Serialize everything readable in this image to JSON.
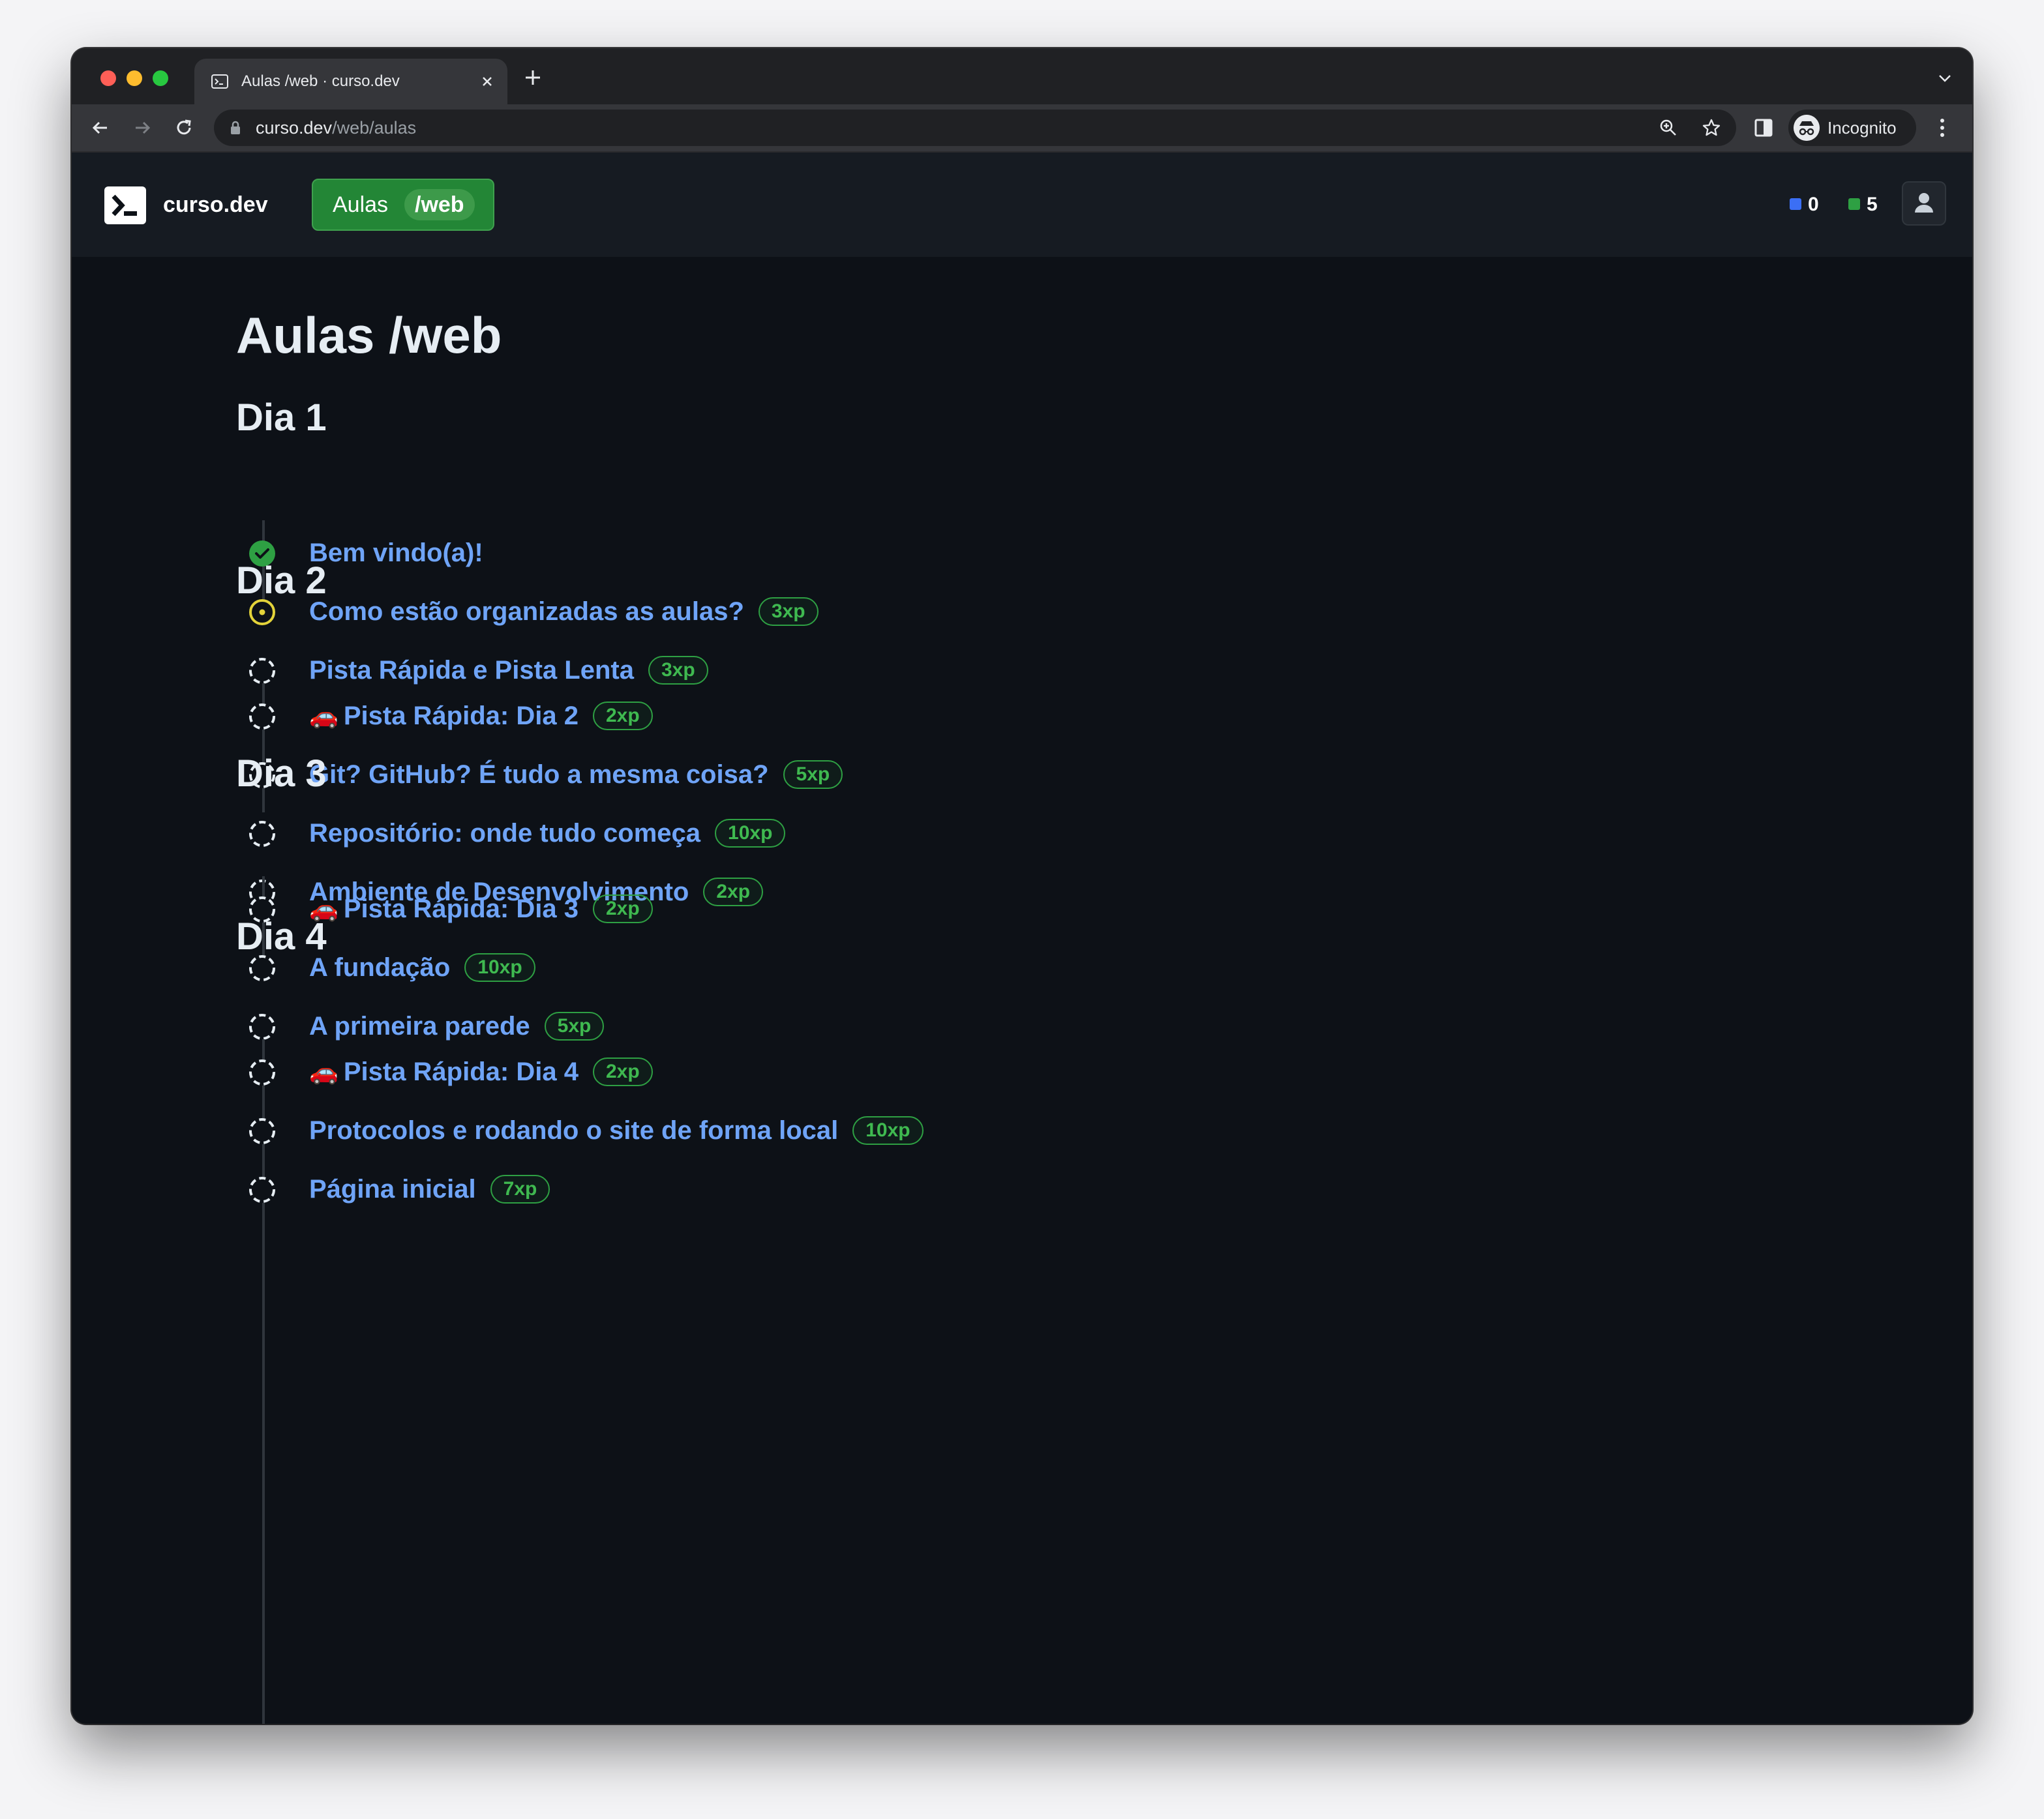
{
  "browser": {
    "tab_title": "Aulas /web · curso.dev",
    "url_host": "curso.dev",
    "url_path": "/web/aulas",
    "profile_label": "Incognito"
  },
  "header": {
    "brand": "curso.dev",
    "section_label": "Aulas",
    "section_tag": "/web",
    "stat_blue": "0",
    "stat_green": "5",
    "colors": {
      "blue_dot": "#3b6ff5",
      "green_dot": "#2ea043",
      "pill": "#238636"
    }
  },
  "page": {
    "title": "Aulas /web",
    "days": [
      {
        "title": "Dia 1",
        "lessons": [
          {
            "title": "Bem vindo(a)!",
            "xp": "",
            "status": "completed",
            "car": false
          },
          {
            "title": "Como estão organizadas as aulas?",
            "xp": "3xp",
            "status": "in-progress",
            "car": false
          },
          {
            "title": "Pista Rápida e Pista Lenta",
            "xp": "3xp",
            "status": "pending",
            "car": false
          }
        ]
      },
      {
        "title": "Dia 2",
        "lessons": [
          {
            "title": "Pista Rápida: Dia 2",
            "xp": "2xp",
            "status": "pending",
            "car": true
          },
          {
            "title": "Git? GitHub? É tudo a mesma coisa?",
            "xp": "5xp",
            "status": "pending",
            "car": false
          },
          {
            "title": "Repositório: onde tudo começa",
            "xp": "10xp",
            "status": "pending",
            "car": false
          },
          {
            "title": "Ambiente de Desenvolvimento",
            "xp": "2xp",
            "status": "pending",
            "car": false
          }
        ]
      },
      {
        "title": "Dia 3",
        "lessons": [
          {
            "title": "Pista Rápida: Dia 3",
            "xp": "2xp",
            "status": "pending",
            "car": true
          },
          {
            "title": "A fundação",
            "xp": "10xp",
            "status": "pending",
            "car": false
          },
          {
            "title": "A primeira parede",
            "xp": "5xp",
            "status": "pending",
            "car": false
          }
        ]
      },
      {
        "title": "Dia 4",
        "lessons": [
          {
            "title": "Pista Rápida: Dia 4",
            "xp": "2xp",
            "status": "pending",
            "car": true
          },
          {
            "title": "Protocolos e rodando o site de forma local",
            "xp": "10xp",
            "status": "pending",
            "car": false
          },
          {
            "title": "Página inicial",
            "xp": "7xp",
            "status": "pending",
            "car": false
          }
        ]
      }
    ]
  },
  "icons": {
    "completed": "check-circle-icon",
    "in-progress": "dot-circle-icon",
    "pending": "dashed-circle-icon",
    "car": "car-emoji-icon"
  }
}
